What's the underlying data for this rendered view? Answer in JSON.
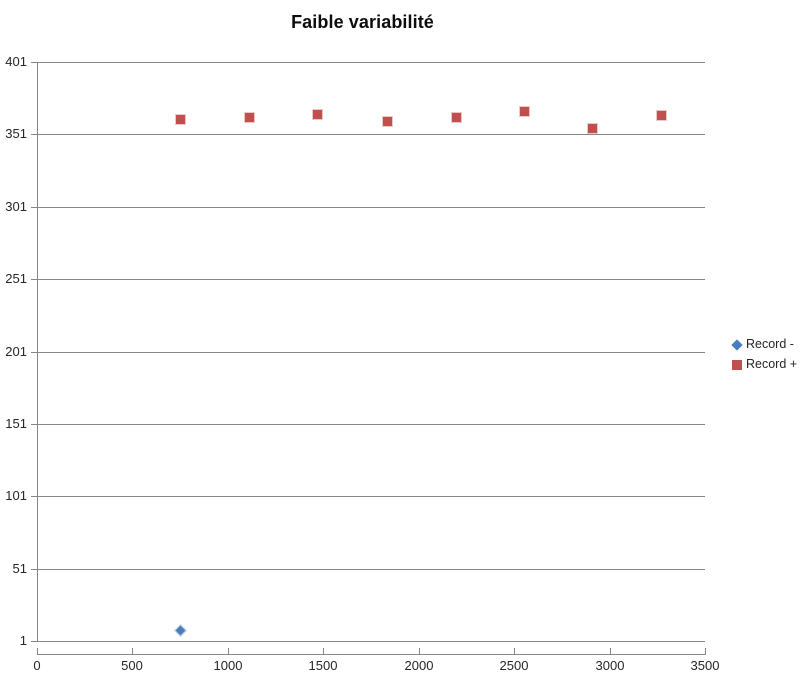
{
  "chart_data": {
    "type": "scatter",
    "title": "Faible variabilité",
    "xlabel": "",
    "ylabel": "",
    "xlim": [
      0,
      3500
    ],
    "ylim": [
      1,
      401
    ],
    "grid": true,
    "legend_position": "right",
    "x_ticks": [
      0,
      500,
      1000,
      1500,
      2000,
      2500,
      3000,
      3500
    ],
    "x_tick_labels": [
      "0",
      "500",
      "1000",
      "1500",
      "2000",
      "2500",
      "3000",
      "3500"
    ],
    "y_ticks": [
      1,
      51,
      101,
      151,
      201,
      251,
      301,
      351,
      401
    ],
    "y_tick_labels": [
      "1",
      "51",
      "101",
      "151",
      "201",
      "251",
      "301",
      "351",
      "401"
    ],
    "series": [
      {
        "name": "Record -",
        "marker": "diamond",
        "color": "#4a7ebb",
        "points": [
          {
            "x": 754,
            "y": 8
          }
        ]
      },
      {
        "name": "Record +",
        "marker": "square",
        "color": "#c0504d",
        "points": [
          {
            "x": 754,
            "y": 361
          },
          {
            "x": 1116,
            "y": 363
          },
          {
            "x": 1472,
            "y": 365
          },
          {
            "x": 1834,
            "y": 360
          },
          {
            "x": 2196,
            "y": 363
          },
          {
            "x": 2552,
            "y": 367
          },
          {
            "x": 2908,
            "y": 355
          },
          {
            "x": 3270,
            "y": 364
          }
        ]
      }
    ]
  },
  "legend": {
    "items": [
      {
        "label": "Record -",
        "marker": "diamond",
        "color": "#4a7ebb"
      },
      {
        "label": "Record +",
        "marker": "square",
        "color": "#c0504d"
      }
    ]
  }
}
